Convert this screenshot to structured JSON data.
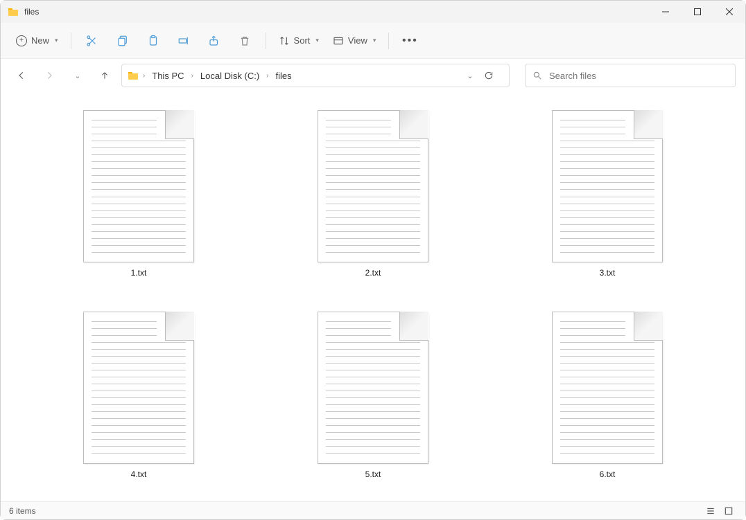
{
  "window": {
    "title": "files"
  },
  "toolbar": {
    "new_label": "New",
    "sort_label": "Sort",
    "view_label": "View"
  },
  "breadcrumb": {
    "items": [
      "This PC",
      "Local Disk (C:)",
      "files"
    ]
  },
  "search": {
    "placeholder": "Search files"
  },
  "files": [
    {
      "name": "1.txt"
    },
    {
      "name": "2.txt"
    },
    {
      "name": "3.txt"
    },
    {
      "name": "4.txt"
    },
    {
      "name": "5.txt"
    },
    {
      "name": "6.txt"
    }
  ],
  "status": {
    "text": "6 items"
  }
}
